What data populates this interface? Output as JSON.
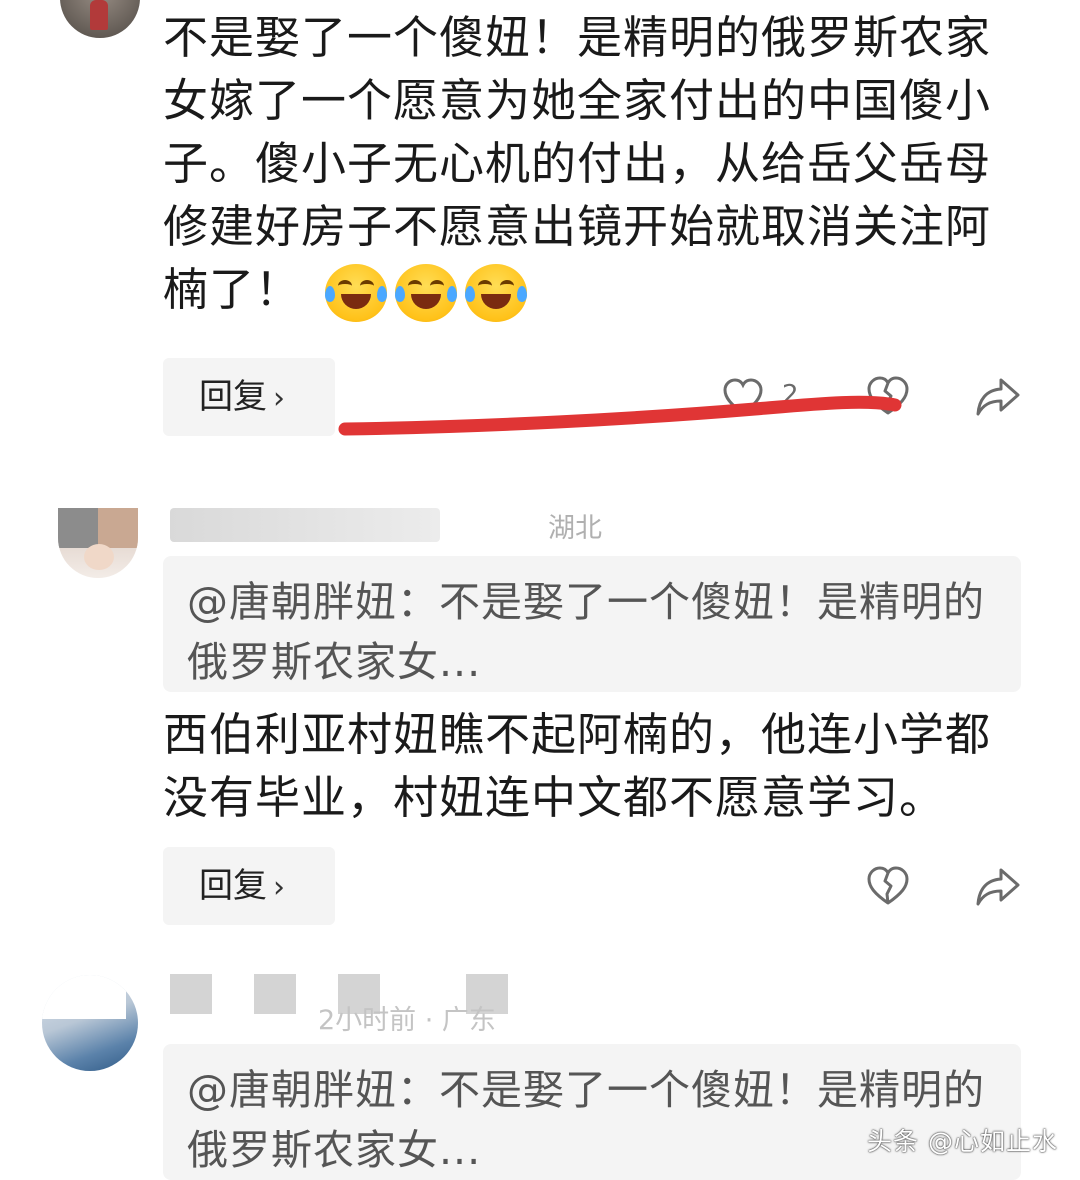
{
  "comment1": {
    "text": "不是娶了一个傻妞！是精明的俄罗斯农家女嫁了一个愿意为她全家付出的中国傻小子。傻小子无心机的付出，从给岳父岳母修建好房子不愿意出镜开始就取消关注阿楠了！",
    "emojis": [
      "laugh-cry-emoji",
      "laugh-cry-emoji",
      "laugh-cry-emoji"
    ],
    "reply_label": "回复",
    "reply_chevron": "›",
    "like_count": "2"
  },
  "comment2": {
    "meta_location": "湖北",
    "quote": "@唐朝胖妞：不是娶了一个傻妞！是精明的俄罗斯农家女...",
    "text": "西伯利亚村妞瞧不起阿楠的，他连小学都没有毕业，村妞连中文都不愿意学习。",
    "reply_label": "回复",
    "reply_chevron": "›"
  },
  "comment3": {
    "meta": "2小时前 · 广东",
    "quote": "@唐朝胖妞：不是娶了一个傻妞！是精明的俄罗斯农家女..."
  },
  "watermark": "头条 @心如止水",
  "colors": {
    "red_stroke": "#e03535",
    "quote_bg": "#f4f4f4",
    "reply_bg": "#f4f4f4",
    "icon_gray": "#6b6b6b"
  },
  "icons": [
    "like-heart-icon",
    "broken-heart-icon",
    "share-icon"
  ]
}
